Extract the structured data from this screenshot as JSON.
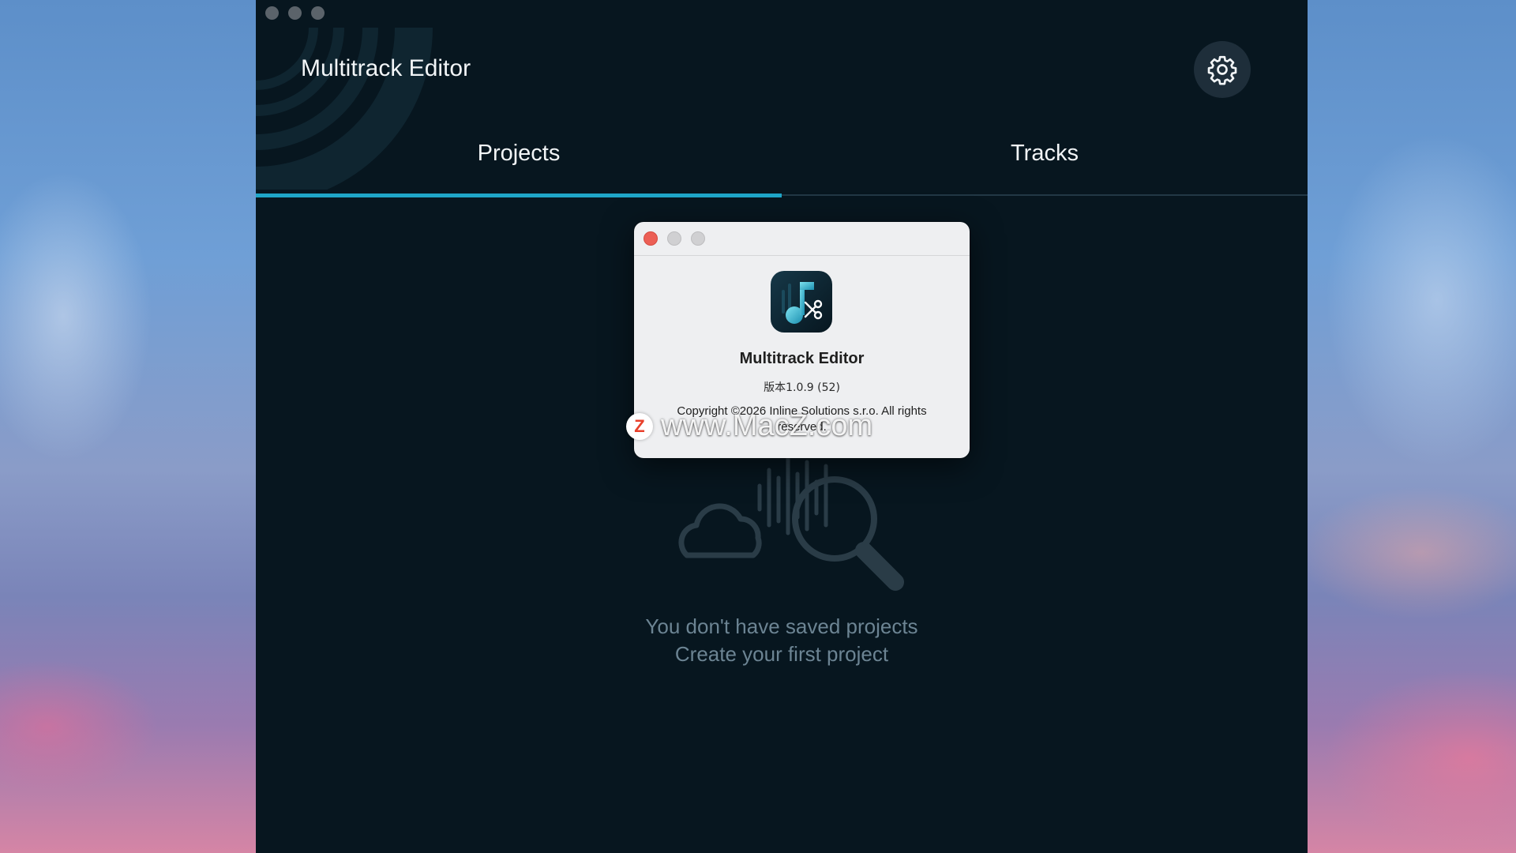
{
  "window": {
    "title": "Multitrack Editor"
  },
  "header": {
    "settings_icon": "gear-icon"
  },
  "tabs": [
    {
      "label": "Projects",
      "active": true
    },
    {
      "label": "Tracks",
      "active": false
    }
  ],
  "empty_state": {
    "illustration_icon": "cloud-search-icon",
    "line1": "You don't have saved projects",
    "line2": "Create your first project"
  },
  "about_dialog": {
    "app_name": "Multitrack Editor",
    "version": "版本1.0.9 (52)",
    "copyright": "Copyright ©2026 Inline Solutions s.r.o. All rights reserved."
  },
  "watermark": {
    "badge": "Z",
    "text": "www.MacZ.com"
  },
  "colors": {
    "window_bg": "#07161f",
    "accent": "#1fa6c8",
    "muted_text": "#6c8493",
    "close_light": "#ec5f55"
  }
}
